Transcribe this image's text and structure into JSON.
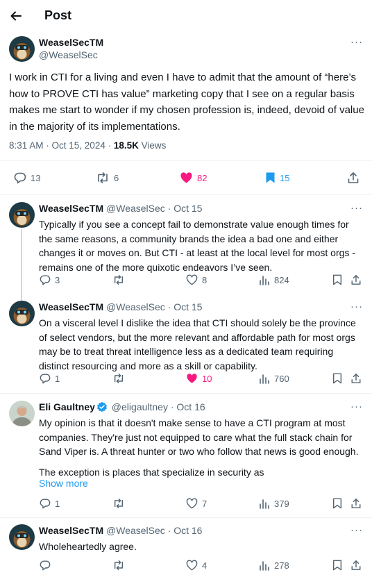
{
  "header": {
    "title": "Post"
  },
  "main_post": {
    "author_name": "WeaselSecTM",
    "author_handle": "@WeaselSec",
    "text": "I work in CTI for a living and even I have to admit that the amount of “here’s how to PROVE CTI has value” marketing copy that I see on a regular basis makes me start to wonder if my chosen profession is, indeed, devoid of value in the majority of its implementations.",
    "time": "8:31 AM · Oct 15, 2024 · ",
    "views_count": "18.5K",
    "views_label": " Views",
    "replies": "13",
    "reposts": "6",
    "likes": "82",
    "bookmarks": "15"
  },
  "replies": [
    {
      "name": "WeaselSecTM",
      "sub": " @WeaselSec · Oct 15",
      "text": "Typically if you see a concept fail to demonstrate value enough times for the same reasons, a community brands the idea a bad one and either changes it or moves on. But CTI - at least at the local level for most orgs - remains one of the more quixotic endeavors I’ve seen.",
      "replies": "3",
      "reposts": "",
      "likes": "8",
      "views": "824"
    },
    {
      "name": "WeaselSecTM",
      "sub": " @WeaselSec · Oct 15",
      "text": "On a visceral level I dislike the idea that CTI should solely be the province of select vendors, but the more relevant and affordable path for most orgs may be to treat threat intelligence less as a dedicated team requiring distinct resourcing and more as a skill or capability.",
      "replies": "1",
      "reposts": "",
      "likes": "10",
      "views": "760"
    },
    {
      "name": "Eli Gaultney",
      "sub": " @eligaultney · Oct 16",
      "text": "My opinion is that it doesn't make sense to have a CTI program at most companies. They're just not equipped to care what the full stack chain for Sand Viper is. A threat hunter or two who follow that news is good enough.",
      "text2": "The exception is places that specialize in security as",
      "show_more": "Show more",
      "replies": "1",
      "reposts": "",
      "likes": "7",
      "views": "379"
    },
    {
      "name": "WeaselSecTM",
      "sub": " @WeaselSec · Oct 16",
      "text": "Wholeheartedly agree.",
      "replies": "",
      "reposts": "",
      "likes": "4",
      "views": "278"
    }
  ],
  "colors": {
    "like_active": "#f91880",
    "bookmark_active": "#1d9bf0",
    "muted": "#536471",
    "verified": "#1d9bf0"
  },
  "icons": [
    "back-arrow-icon",
    "more-icon",
    "reply-icon",
    "repost-icon",
    "heart-icon",
    "bookmark-icon",
    "share-icon",
    "views-icon",
    "verified-badge-icon"
  ]
}
